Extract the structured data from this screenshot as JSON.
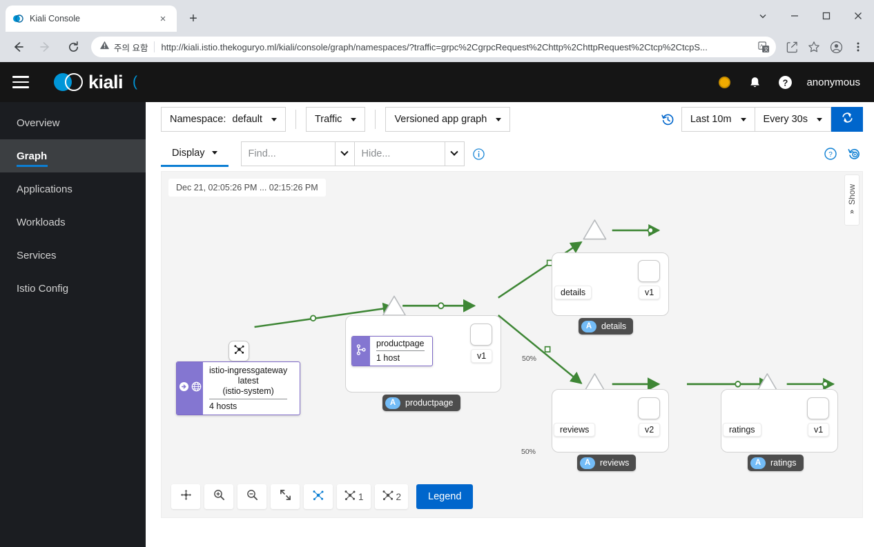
{
  "browser": {
    "tab_title": "Kiali Console",
    "tab_favicon": "kiali-logo-icon",
    "new_tab_label": "+",
    "close_label": "×",
    "security_warning": "주의 요함",
    "url": "http://kiali.istio.thekoguryo.ml/kiali/console/graph/namespaces/?traffic=grpc%2CgrpcRequest%2Chttp%2ChttpRequest%2Ctcp%2CtcpS...",
    "url_scheme": "http://",
    "url_rest": "kiali.istio.thekoguryo.ml/kiali/console/graph/namespaces/?traffic=grpc%2CgrpcRequest%2Chttp%2ChttpRequest%2Ctcp%2CtcpS...",
    "icons": {
      "back": "back-arrow-icon",
      "forward": "forward-arrow-icon",
      "reload": "reload-icon",
      "warning": "warning-triangle-icon",
      "translate": "translate-icon",
      "share": "share-icon",
      "bookmark": "star-icon",
      "profile": "profile-avatar-icon",
      "menu": "kebab-menu-icon",
      "minimize": "minimize-icon",
      "maximize": "maximize-icon",
      "window_close": "window-close-icon",
      "tab_list": "chevron-down-icon"
    }
  },
  "masthead": {
    "menu_icon": "hamburger-menu-icon",
    "brand": "kiali",
    "brand_suffix": "(",
    "status_icon": "status-circle-icon",
    "bell_icon": "bell-icon",
    "help_icon": "help-circle-icon",
    "user": "anonymous"
  },
  "sidebar": {
    "items": [
      {
        "label": "Overview",
        "active": false
      },
      {
        "label": "Graph",
        "active": true
      },
      {
        "label": "Applications",
        "active": false
      },
      {
        "label": "Workloads",
        "active": false
      },
      {
        "label": "Services",
        "active": false
      },
      {
        "label": "Istio Config",
        "active": false
      }
    ]
  },
  "toolbar": {
    "namespace_label": "Namespace:",
    "namespace_value": "default",
    "traffic_label": "Traffic",
    "graph_type": "Versioned app graph",
    "display_label": "Display",
    "find_placeholder": "Find...",
    "find_value": "",
    "hide_placeholder": "Hide...",
    "hide_value": "",
    "info_icon": "info-circle-icon",
    "history_icon": "history-clock-icon",
    "time_range": "Last 10m",
    "refresh_interval": "Every 30s",
    "refresh_icon": "refresh-icon",
    "help_icon": "help-circle-icon",
    "replay_icon": "replay-icon"
  },
  "graph": {
    "time_range_pill": "Dec 21, 02:05:26 PM ... 02:15:26 PM",
    "show_tab_label": "Show",
    "show_tab_icon": "chevron-double-left-icon",
    "entry_node_icon": "service-entry-icon",
    "gateway": {
      "line1": "istio-ingressgateway",
      "line2": "latest",
      "line3": "(istio-system)",
      "hosts": "4 hosts",
      "icon1": "arrow-circle-right-icon",
      "icon2": "globe-gateway-icon"
    },
    "productpage": {
      "service_label": "productpage",
      "version_label": "v1",
      "app_badge": "A",
      "app_label": "productpage",
      "route_title": "productpage",
      "route_hosts": "1 host",
      "route_icon": "virtual-service-branch-icon"
    },
    "details": {
      "service_label": "details",
      "version_label": "v1",
      "app_badge": "A",
      "app_label": "details",
      "edge_pct": "50%"
    },
    "reviews": {
      "service_label": "reviews",
      "version_label": "v2",
      "app_badge": "A",
      "app_label": "reviews",
      "edge_pct": "50%"
    },
    "ratings": {
      "service_label": "ratings",
      "version_label": "v1",
      "app_badge": "A",
      "app_label": "ratings"
    },
    "bottom_toolbar": {
      "pan_icon": "pan-move-icon",
      "zoom_in_icon": "zoom-in-icon",
      "zoom_out_icon": "zoom-out-icon",
      "fit_icon": "expand-fit-icon",
      "layout_default_icon": "graph-layout-icon",
      "layout1_icon": "graph-layout-icon",
      "layout1_label": "1",
      "layout2_icon": "graph-layout-icon",
      "layout2_label": "2",
      "legend_label": "Legend"
    }
  },
  "colors": {
    "accent_blue": "#0066cc",
    "edge_green": "#3e8635",
    "node_purple": "#8476d1",
    "badge_blue": "#73bcf7",
    "status_orange": "#f0ab00",
    "masthead_black": "#151515",
    "sidebar_dark": "#1b1d21"
  }
}
